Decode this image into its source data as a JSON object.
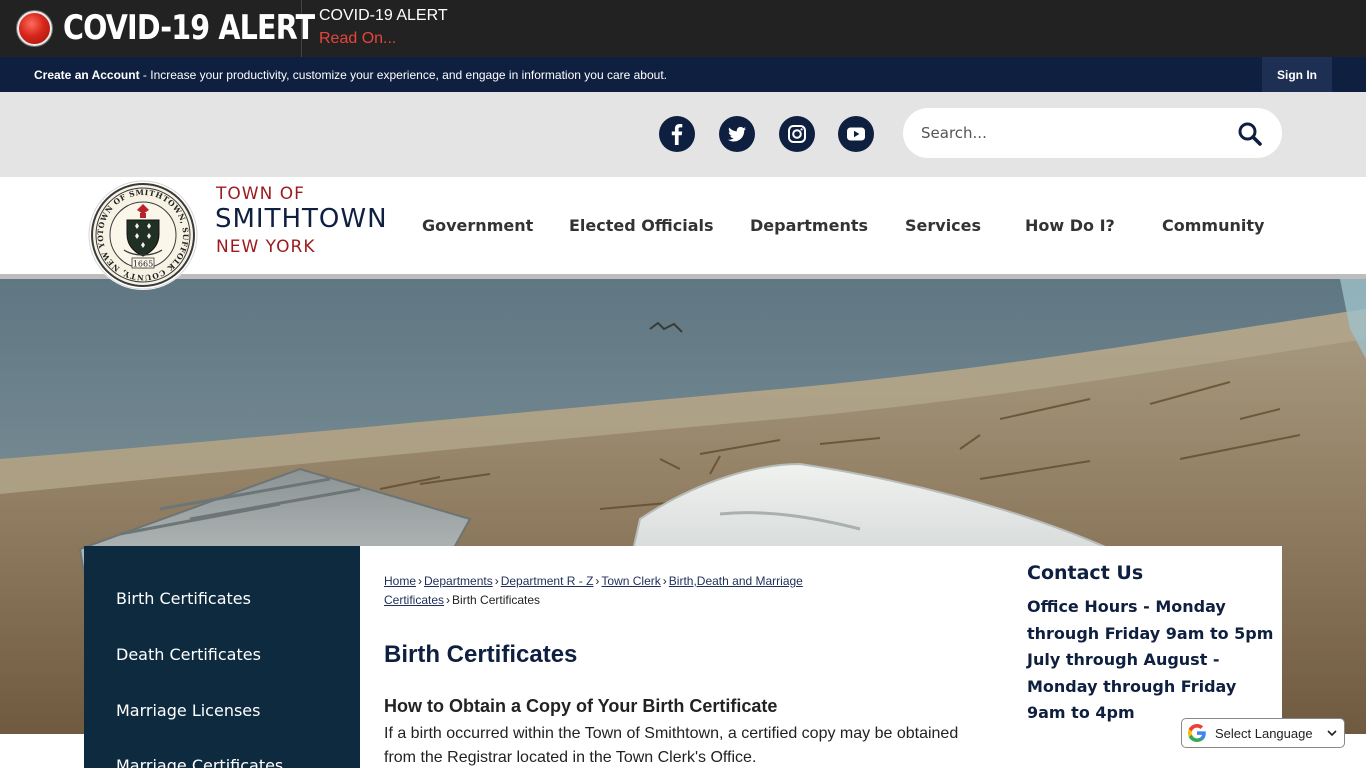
{
  "alert": {
    "badge_text": "COVID-19 ALERT",
    "title": "COVID-19 ALERT",
    "link_text": "Read On..."
  },
  "account_bar": {
    "create_account_link": "Create an Account",
    "description": " - Increase your productivity, customize your experience, and engage in information you care about.",
    "sign_in": "Sign In"
  },
  "social": {
    "icons": [
      "facebook-icon",
      "twitter-icon",
      "instagram-icon",
      "youtube-icon"
    ]
  },
  "search": {
    "placeholder": "Search..."
  },
  "brand": {
    "town_of": "TOWN OF",
    "name": "SMITHTOWN",
    "state": "NEW YORK",
    "seal_text": "TOWN OF SMITHTOWN, SUFFOLK COUNTY, NEW YORK",
    "seal_year": "1665"
  },
  "nav": {
    "items": [
      "Government",
      "Elected Officials",
      "Departments",
      "Services",
      "How Do I?",
      "Community"
    ]
  },
  "sidenav": {
    "items": [
      "Birth Certificates",
      "Death Certificates",
      "Marriage Licenses",
      "Marriage Certificates"
    ]
  },
  "breadcrumb": {
    "links": [
      "Home",
      "Departments",
      "Department R - Z",
      "Town Clerk",
      "Birth,Death and Marriage Certificates"
    ],
    "current": "Birth Certificates"
  },
  "content": {
    "title": "Birth Certificates",
    "heading": "How to Obtain a Copy of Your Birth Certificate",
    "body": "If a birth occurred within the Town of Smithtown, a certified copy may be obtained from the Registrar located in the Town Clerk's Office."
  },
  "contact": {
    "title": "Contact Us",
    "hours": "Office Hours - Monday through Friday 9am to 5pm July through August - Monday through Friday 9am to 4pm"
  },
  "translate": {
    "label": "Select Language"
  },
  "colors": {
    "alert_bar": "#222222",
    "alert_red": "#e8453a",
    "navy": "#0e1f3f",
    "brand_red": "#9c1b1f",
    "sidenav": "#0e2a3f"
  }
}
